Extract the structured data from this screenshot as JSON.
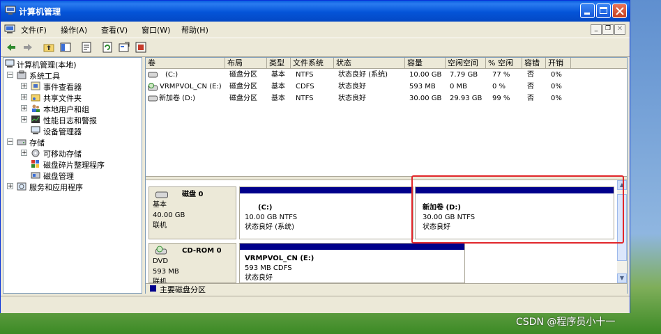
{
  "window": {
    "title": "计算机管理"
  },
  "menu": [
    {
      "label": "文件(F)"
    },
    {
      "label": "操作(A)"
    },
    {
      "label": "查看(V)"
    },
    {
      "label": "窗口(W)"
    },
    {
      "label": "帮助(H)"
    }
  ],
  "tree": {
    "root": "计算机管理(本地)",
    "system_tools": "系统工具",
    "event_viewer": "事件查看器",
    "shared_folders": "共享文件夹",
    "local_users": "本地用户和组",
    "perf_logs": "性能日志和警报",
    "device_manager": "设备管理器",
    "storage": "存储",
    "removable": "可移动存储",
    "defrag": "磁盘碎片整理程序",
    "disk_mgmt": "磁盘管理",
    "services": "服务和应用程序"
  },
  "columns": [
    "卷",
    "布局",
    "类型",
    "文件系统",
    "状态",
    "容量",
    "空闲空间",
    "% 空闲",
    "容错",
    "开销"
  ],
  "volumes": [
    [
      "(C:)",
      "磁盘分区",
      "基本",
      "NTFS",
      "状态良好 (系统)",
      "10.00 GB",
      "7.79 GB",
      "77 %",
      "否",
      "0%"
    ],
    [
      "VRMPVOL_CN (E:)",
      "磁盘分区",
      "基本",
      "CDFS",
      "状态良好",
      "593 MB",
      "0 MB",
      "0 %",
      "否",
      "0%"
    ],
    [
      "新加卷 (D:)",
      "磁盘分区",
      "基本",
      "NTFS",
      "状态良好",
      "30.00 GB",
      "29.93 GB",
      "99 %",
      "否",
      "0%"
    ]
  ],
  "disks": {
    "disk0": {
      "name": "磁盘 0",
      "type": "基本",
      "size": "40.00 GB",
      "state": "联机"
    },
    "cdrom0": {
      "name": "CD-ROM 0",
      "type": "DVD",
      "size": "593 MB",
      "state": "联机"
    }
  },
  "partitions": {
    "c": {
      "name": "(C:)",
      "info": "10.00 GB NTFS",
      "status": "状态良好 (系统)"
    },
    "d": {
      "name": "新加卷  (D:)",
      "info": "30.00 GB NTFS",
      "status": "状态良好"
    },
    "e": {
      "name": "VRMPVOL_CN   (E:)",
      "info": "593 MB CDFS",
      "status": "状态良好"
    }
  },
  "legend": {
    "primary": "主要磁盘分区"
  },
  "watermark": "CSDN @程序员小十一",
  "colors": {
    "partition_bar": "#00008b",
    "highlight": "#e1262a",
    "title_blue": "#0454d8"
  }
}
